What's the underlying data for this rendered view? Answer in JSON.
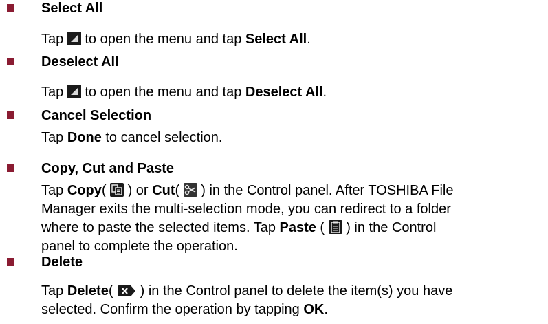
{
  "items": [
    {
      "title": "Select All",
      "text": {
        "pre": "Tap ",
        "mid": " to open the menu and tap ",
        "bold": "Select All",
        "end": "."
      },
      "icon": "menu-icon"
    },
    {
      "title": "Deselect All",
      "text": {
        "pre": "Tap ",
        "mid": " to open the menu and tap ",
        "bold": "Deselect All",
        "end": "."
      },
      "icon": "menu-icon"
    },
    {
      "title": "Cancel Selection",
      "text": {
        "pre": "Tap ",
        "bold": "Done",
        "end": " to cancel selection."
      }
    },
    {
      "title": "Copy, Cut and Paste",
      "lines": [
        {
          "p1": "Tap ",
          "b1": "Copy",
          "p2": "( ",
          "p3": " ) or ",
          "b2": "Cut",
          "p4": "( ",
          "p5": " ) in the Control panel. After TOSHIBA File"
        },
        {
          "text": "Manager exits the multi-selection mode, you can redirect to a folder"
        },
        {
          "p1": "where to paste the selected items. Tap ",
          "b1": "Paste",
          "p2": " ( ",
          "p3": " ) in the Control"
        },
        {
          "text": "panel to complete the operation."
        }
      ],
      "icons": [
        "copy-icon",
        "cut-icon",
        "paste-icon"
      ]
    },
    {
      "title": "Delete",
      "lines": [
        {
          "p1": "Tap ",
          "b1": "Delete",
          "p2": "( ",
          "p3": " ) in the Control panel to delete the item(s) you have"
        },
        {
          "p1": "selected. Confirm the operation by tapping ",
          "b1": "OK",
          "p2": "."
        }
      ],
      "icons": [
        "delete-icon"
      ]
    }
  ],
  "colors": {
    "bullet": "#8a1c32",
    "icon_dark": "#1a1a1a"
  }
}
